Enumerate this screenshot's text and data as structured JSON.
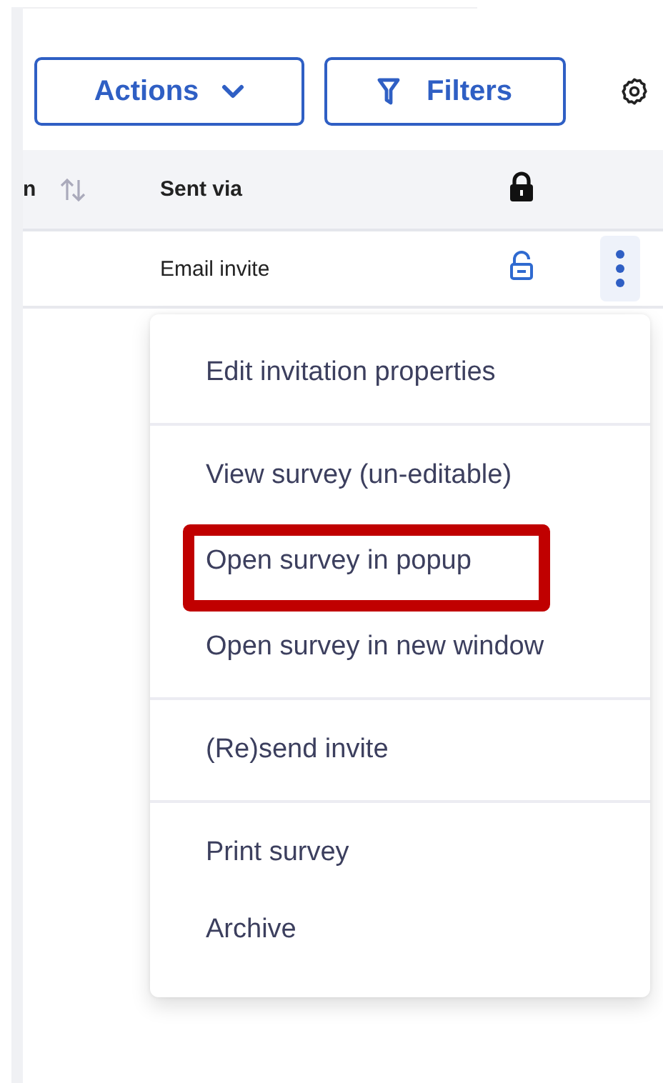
{
  "toolbar": {
    "buttons": [
      {
        "label": "Actions",
        "kind": "dropdown"
      },
      {
        "label": "Filters",
        "kind": "filter"
      }
    ]
  },
  "table": {
    "columns": [
      {
        "label": "n",
        "sortable": true,
        "kind": "text"
      },
      {
        "label": "Sent via",
        "sortable": false,
        "kind": "text"
      },
      {
        "kind": "lock"
      }
    ],
    "rows": [
      {
        "sent_via": "Email invite",
        "locked": false
      }
    ]
  },
  "menu": {
    "groups": [
      [
        {
          "label": "Edit invitation properties",
          "highlighted": false
        }
      ],
      [
        {
          "label": "View survey (un-editable)",
          "highlighted": false
        },
        {
          "label": "Open survey in popup",
          "highlighted": true
        },
        {
          "label": "Open survey in new window",
          "highlighted": false
        }
      ],
      [
        {
          "label": "(Re)send invite",
          "highlighted": false
        }
      ],
      [
        {
          "label": "Print survey",
          "highlighted": false
        },
        {
          "label": "Archive",
          "highlighted": false
        }
      ]
    ]
  }
}
